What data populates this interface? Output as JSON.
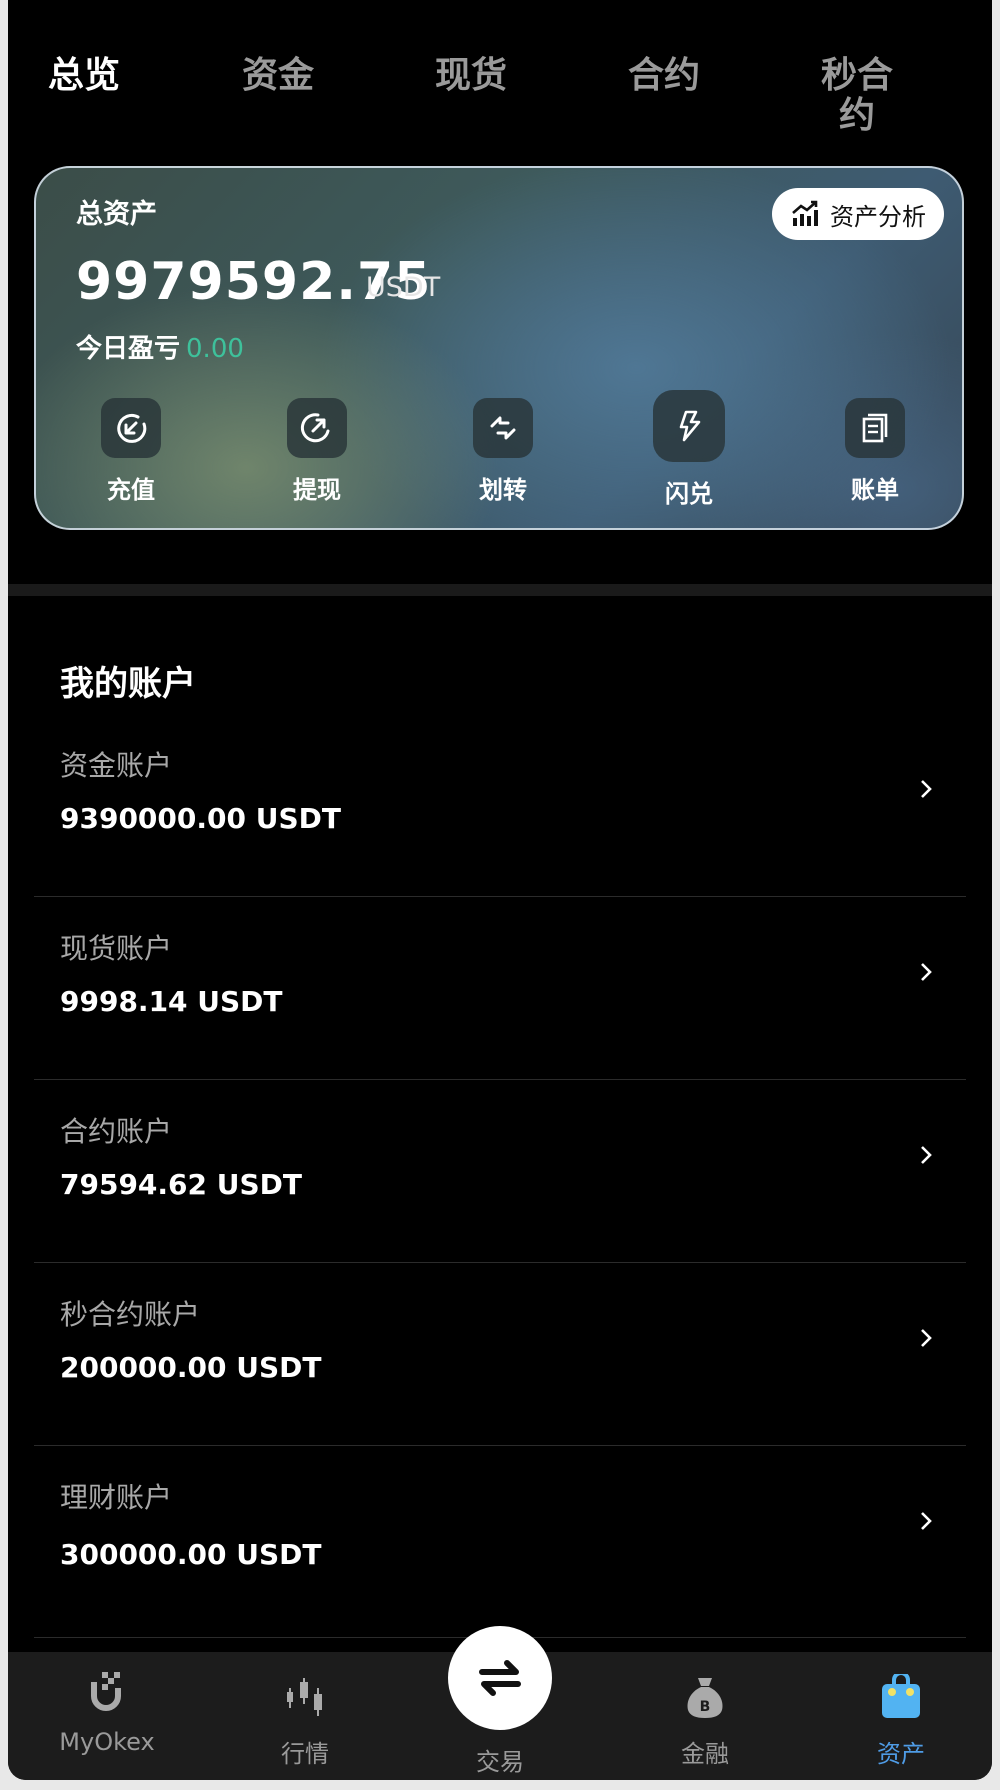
{
  "tabs": [
    {
      "label": "总览",
      "active": true
    },
    {
      "label": "资金",
      "active": false
    },
    {
      "label": "现货",
      "active": false
    },
    {
      "label": "合约",
      "active": false
    },
    {
      "label": "秒合约",
      "active": false
    }
  ],
  "summary": {
    "title": "总资产",
    "analysis_label": "资产分析",
    "total_value": "9979592.75",
    "total_unit": "USDT",
    "pnl_label": "今日盈亏",
    "pnl_value": "0.00"
  },
  "actions": [
    {
      "label": "充值",
      "icon": "deposit-icon"
    },
    {
      "label": "提现",
      "icon": "withdraw-icon"
    },
    {
      "label": "划转",
      "icon": "transfer-icon"
    },
    {
      "label": "闪兑",
      "icon": "flash-swap-icon"
    },
    {
      "label": "账单",
      "icon": "bill-icon"
    }
  ],
  "accounts": {
    "title": "我的账户",
    "items": [
      {
        "name": "资金账户",
        "value": "9390000.00 USDT"
      },
      {
        "name": "现货账户",
        "value": "9998.14 USDT"
      },
      {
        "name": "合约账户",
        "value": "79594.62 USDT"
      },
      {
        "name": "秒合约账户",
        "value": "200000.00 USDT"
      },
      {
        "name": "理财账户",
        "value": "300000.00 USDT"
      }
    ]
  },
  "bottom_nav": [
    {
      "label": "MyOkex",
      "icon": "myokex-icon",
      "active": false
    },
    {
      "label": "行情",
      "icon": "market-icon",
      "active": false
    },
    {
      "label": "交易",
      "icon": "trade-icon",
      "active": false
    },
    {
      "label": "金融",
      "icon": "finance-icon",
      "active": false
    },
    {
      "label": "资产",
      "icon": "assets-icon",
      "active": true
    }
  ],
  "colors": {
    "pnl": "#3ec19b",
    "active_nav": "#4f9ce6",
    "background": "#000000"
  }
}
